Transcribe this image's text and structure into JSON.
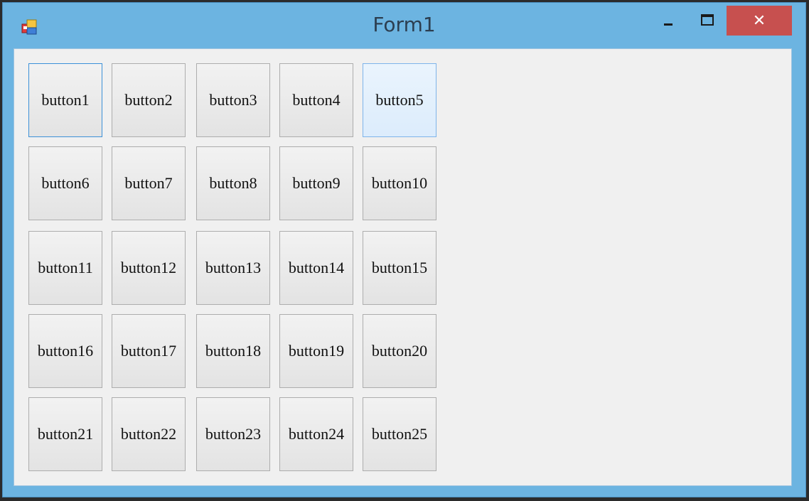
{
  "window": {
    "title": "Form1",
    "icon": "winforms-app-icon",
    "controls": {
      "minimize_icon": "minimize-icon",
      "maximize_icon": "maximize-icon",
      "close_icon": "close-icon",
      "close_glyph": "✕"
    }
  },
  "colors": {
    "titlebar": "#6cb4e1",
    "close_button": "#c7504f",
    "client_area": "#f0f0f0",
    "focus_border": "#3c91d8",
    "hover_border": "#7eb4ea"
  },
  "buttons": [
    {
      "label": "button1",
      "state": "focused"
    },
    {
      "label": "button2",
      "state": "normal"
    },
    {
      "label": "button3",
      "state": "normal"
    },
    {
      "label": "button4",
      "state": "normal"
    },
    {
      "label": "button5",
      "state": "hover"
    },
    {
      "label": "button6",
      "state": "normal"
    },
    {
      "label": "button7",
      "state": "normal"
    },
    {
      "label": "button8",
      "state": "normal"
    },
    {
      "label": "button9",
      "state": "normal"
    },
    {
      "label": "button10",
      "state": "normal"
    },
    {
      "label": "button11",
      "state": "normal"
    },
    {
      "label": "button12",
      "state": "normal"
    },
    {
      "label": "button13",
      "state": "normal"
    },
    {
      "label": "button14",
      "state": "normal"
    },
    {
      "label": "button15",
      "state": "normal"
    },
    {
      "label": "button16",
      "state": "normal"
    },
    {
      "label": "button17",
      "state": "normal"
    },
    {
      "label": "button18",
      "state": "normal"
    },
    {
      "label": "button19",
      "state": "normal"
    },
    {
      "label": "button20",
      "state": "normal"
    },
    {
      "label": "button21",
      "state": "normal"
    },
    {
      "label": "button22",
      "state": "normal"
    },
    {
      "label": "button23",
      "state": "normal"
    },
    {
      "label": "button24",
      "state": "normal"
    },
    {
      "label": "button25",
      "state": "normal"
    }
  ]
}
